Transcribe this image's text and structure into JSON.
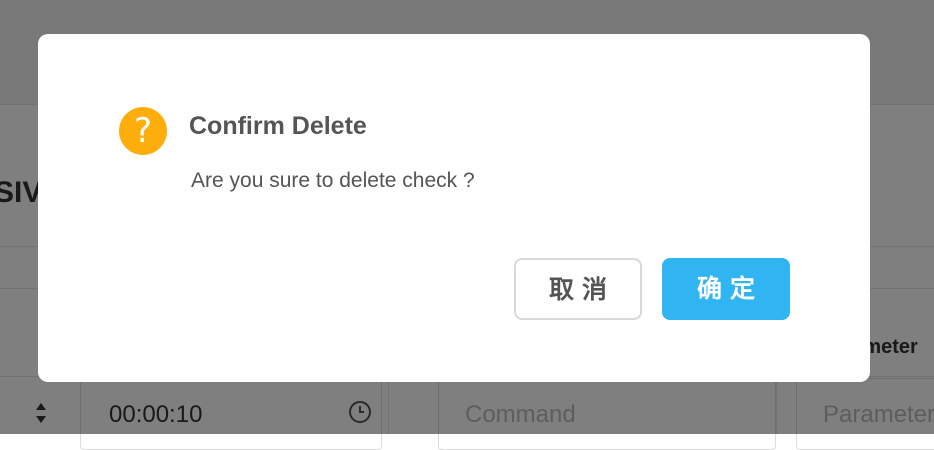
{
  "background": {
    "section_title": "SIV",
    "column_header_parameter": "Parameter",
    "time_value": "00:00:10",
    "command_placeholder": "Command",
    "parameter_placeholder": "Parameter"
  },
  "dialog": {
    "icon_glyph": "?",
    "title": "Confirm Delete",
    "message": "Are you sure to delete check ?",
    "cancel_label": "取消",
    "confirm_label": "确定"
  },
  "colors": {
    "warning_icon": "#fdae0c",
    "primary_button": "#30b4f2",
    "overlay": "rgba(0,0,0,0.5)"
  }
}
